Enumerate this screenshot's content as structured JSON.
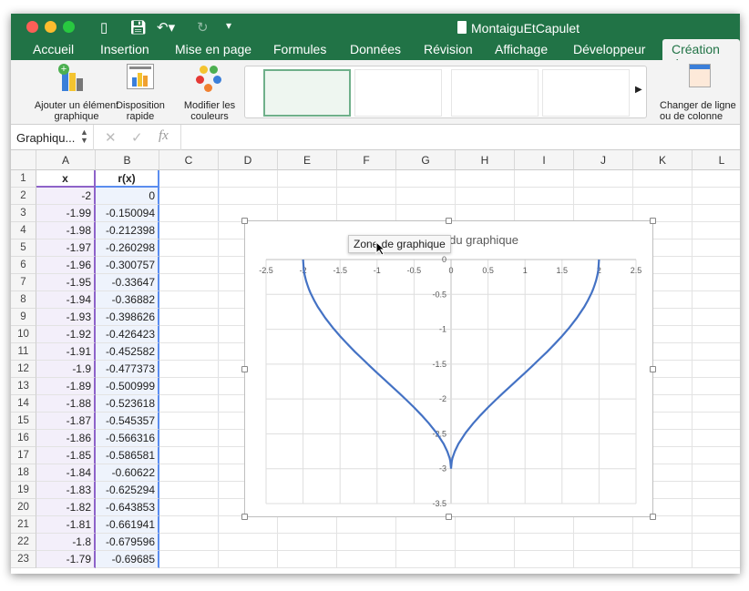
{
  "window": {
    "title": "MontaiguEtCapulet"
  },
  "tabs": [
    "Accueil",
    "Insertion",
    "Mise en page",
    "Formules",
    "Données",
    "Révision",
    "Affichage",
    "Développeur",
    "Création de"
  ],
  "active_tab": "Création de",
  "ribbon": {
    "add_element": "Ajouter un élément graphique",
    "quick_layout": "Disposition rapide",
    "change_colors": "Modifier les couleurs",
    "switch_row_col": "Changer de ligne ou de colonne",
    "gallery_next": "▶"
  },
  "formula_bar": {
    "name_box": "Graphiqu...",
    "cancel": "✕",
    "confirm": "✓",
    "fx": "fx",
    "value": ""
  },
  "columns": [
    "A",
    "B",
    "C",
    "D",
    "E",
    "F",
    "G",
    "H",
    "I",
    "J",
    "K",
    "L"
  ],
  "table": {
    "headers": [
      "x",
      "r(x)"
    ],
    "rows": [
      [
        "-2",
        "0"
      ],
      [
        "-1.99",
        "-0.150094"
      ],
      [
        "-1.98",
        "-0.212398"
      ],
      [
        "-1.97",
        "-0.260298"
      ],
      [
        "-1.96",
        "-0.300757"
      ],
      [
        "-1.95",
        "-0.33647"
      ],
      [
        "-1.94",
        "-0.36882"
      ],
      [
        "-1.93",
        "-0.398626"
      ],
      [
        "-1.92",
        "-0.426423"
      ],
      [
        "-1.91",
        "-0.452582"
      ],
      [
        "-1.9",
        "-0.477373"
      ],
      [
        "-1.89",
        "-0.500999"
      ],
      [
        "-1.88",
        "-0.523618"
      ],
      [
        "-1.87",
        "-0.545357"
      ],
      [
        "-1.86",
        "-0.566316"
      ],
      [
        "-1.85",
        "-0.586581"
      ],
      [
        "-1.84",
        "-0.60622"
      ],
      [
        "-1.83",
        "-0.625294"
      ],
      [
        "-1.82",
        "-0.643853"
      ],
      [
        "-1.81",
        "-0.661941"
      ],
      [
        "-1.8",
        "-0.679596"
      ],
      [
        "-1.79",
        "-0.69685"
      ]
    ]
  },
  "tooltip": "Zone de graphique",
  "chart_data": {
    "type": "scatter",
    "title": "Titre du graphique",
    "xlim": [
      -2.5,
      2.5
    ],
    "ylim": [
      -3.5,
      0
    ],
    "xticks": [
      "-2.5",
      "-2",
      "-1.5",
      "-1",
      "-0.5",
      "0",
      "0.5",
      "1",
      "1.5",
      "2",
      "2.5"
    ],
    "yticks": [
      "0",
      "-0.5",
      "-1",
      "-1.5",
      "-2",
      "-2.5",
      "-3",
      "-3.5"
    ],
    "grid": true,
    "legend": "none",
    "line_color": "#4472c4",
    "x": [
      -2,
      -1.99,
      -1.98,
      -1.96,
      -1.94,
      -1.92,
      -1.9,
      -1.85,
      -1.8,
      -1.7,
      -1.6,
      -1.5,
      -1.4,
      -1.3,
      -1.2,
      -1.1,
      -1,
      -0.9,
      -0.8,
      -0.7,
      -0.6,
      -0.5,
      -0.4,
      -0.3,
      -0.2,
      -0.1,
      -0.05,
      -0.02,
      -0.01,
      0,
      0.01,
      0.02,
      0.05,
      0.1,
      0.2,
      0.3,
      0.4,
      0.5,
      0.6,
      0.7,
      0.8,
      0.9,
      1,
      1.1,
      1.2,
      1.3,
      1.4,
      1.5,
      1.6,
      1.7,
      1.8,
      1.85,
      1.9,
      1.92,
      1.94,
      1.96,
      1.98,
      1.99,
      2
    ],
    "y": [
      0,
      -0.150094,
      -0.212398,
      -0.300757,
      -0.36882,
      -0.426423,
      -0.477373,
      -0.586581,
      -0.679596,
      -0.838,
      -0.975,
      -1.098,
      -1.212,
      -1.321,
      -1.424,
      -1.525,
      -1.624,
      -1.721,
      -1.819,
      -1.917,
      -2.018,
      -2.121,
      -2.231,
      -2.348,
      -2.481,
      -2.643,
      -2.753,
      -2.846,
      -2.892,
      -3,
      -2.892,
      -2.846,
      -2.753,
      -2.643,
      -2.481,
      -2.348,
      -2.231,
      -2.121,
      -2.018,
      -1.917,
      -1.819,
      -1.721,
      -1.624,
      -1.525,
      -1.424,
      -1.321,
      -1.212,
      -1.098,
      -0.975,
      -0.838,
      -0.679596,
      -0.586581,
      -0.477373,
      -0.426423,
      -0.36882,
      -0.300757,
      -0.212398,
      -0.150094,
      0
    ]
  }
}
